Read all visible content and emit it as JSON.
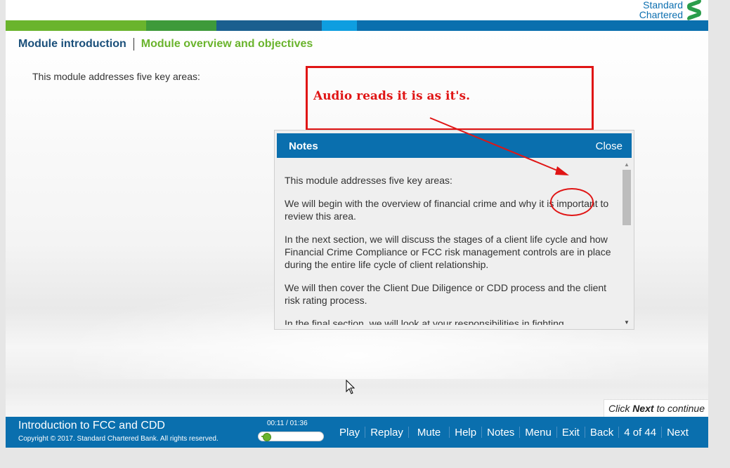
{
  "brand": {
    "line1": "Standard",
    "line2": "Chartered",
    "accent": "#0c6fb0",
    "mark_color": "#2a9d4b"
  },
  "colorbar": [
    "#6ab42d",
    "#3e9a3a",
    "#1a5f8f",
    "#0e9ee0",
    "#0a6fae"
  ],
  "breadcrumb": {
    "section": "Module introduction",
    "topic": "Module overview and objectives"
  },
  "content": {
    "intro": "This module addresses five key areas:"
  },
  "annotation": {
    "text": "Audio reads it is as it's.",
    "color": "#e01515"
  },
  "notes": {
    "title": "Notes",
    "close_label": "Close",
    "paragraphs": [
      "This module addresses five key areas:",
      "We will begin with the overview of financial crime and why it is important to review this area.",
      "In the next section, we will discuss the stages of a client life cycle and how Financial Crime Compliance or FCC risk management controls are in place during the entire life cycle of client relationship.",
      "We will then cover the Client Due Diligence or CDD process and the client risk rating process.",
      "In the final section, we will look at your responsibilities in fighting"
    ]
  },
  "continue_hint": {
    "prefix": "Click ",
    "bold": "Next",
    "suffix": " to continue"
  },
  "footer": {
    "course_title": "Introduction to FCC and CDD",
    "copyright": "Copyright © 2017. Standard Chartered Bank. All rights reserved.",
    "time": "00:11 / 01:36",
    "progress": 0.115,
    "buttons": {
      "play": "Play",
      "replay": "Replay",
      "mute": "Mute",
      "help": "Help",
      "notes": "Notes",
      "menu": "Menu",
      "exit": "Exit",
      "back": "Back",
      "page": "4 of 44",
      "next": "Next"
    },
    "bar_color": "#0a6fae"
  }
}
